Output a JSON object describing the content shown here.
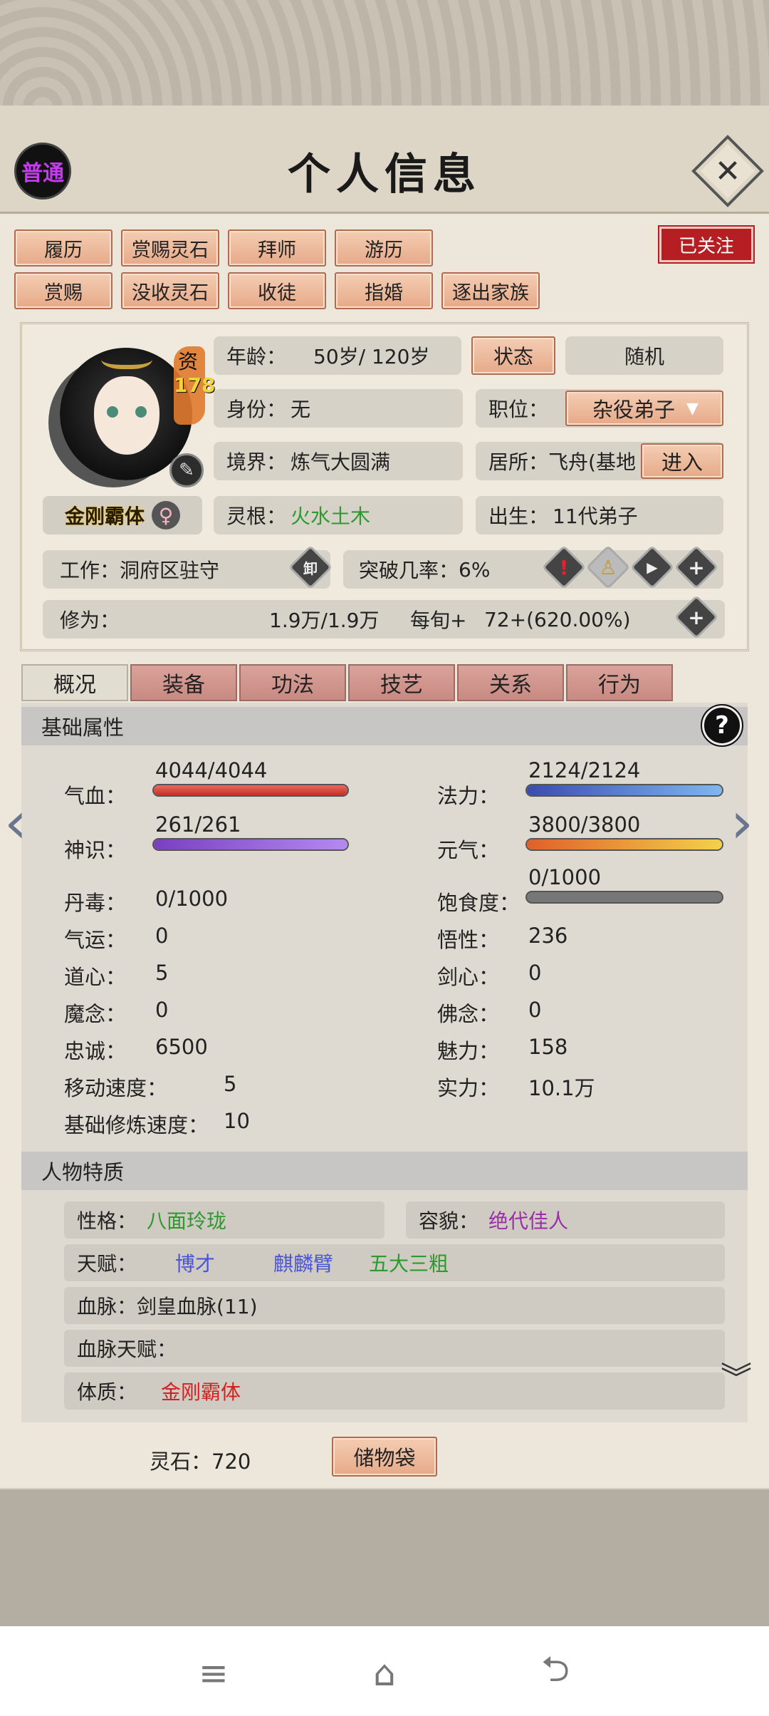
{
  "header": {
    "title": "个人信息",
    "grade_badge": "普通",
    "close_label": "✕"
  },
  "actions_row1": [
    "履历",
    "赏赐灵石",
    "拜师",
    "游历"
  ],
  "actions_row2": [
    "赏赐",
    "没收灵石",
    "收徒",
    "指婚",
    "逐出家族"
  ],
  "follow_label": "已关注",
  "profile": {
    "aptitude_char": "资",
    "aptitude_value": "178",
    "body_type": "金刚霸体",
    "gender_icon": "♀",
    "age_label": "年龄：",
    "age_value": "50岁/ 120岁",
    "status_button": "状态",
    "random_button": "随机",
    "identity_label": "身份：",
    "identity_value": "无",
    "position_label": "职位：",
    "position_value": "杂役弟子",
    "realm_label": "境界：",
    "realm_value": "炼气大圆满",
    "residence_label": "居所：",
    "residence_value": "飞舟(基地",
    "enter_button": "进入",
    "root_label": "灵根：",
    "root_value": "火水土木",
    "birth_label": "出生：",
    "birth_value": "11代弟子",
    "work_label": "工作：",
    "work_value": "洞府区驻守",
    "work_icon_text": "卸",
    "breakthrough_label": "突破几率：",
    "breakthrough_value": "6%",
    "cultivation_label": "修为：",
    "cultivation_value": "1.9万/1.9万",
    "per_period_label": "每旬+",
    "per_period_value": "72+(620.00%)"
  },
  "tabs": [
    "概况",
    "装备",
    "功法",
    "技艺",
    "关系",
    "行为"
  ],
  "attributes": {
    "section_title": "基础属性",
    "help_label": "?",
    "qixue_label": "气血：",
    "qixue_value": "4044/4044",
    "qixue_fill": 1.0,
    "fali_label": "法力：",
    "fali_value": "2124/2124",
    "fali_fill": 1.0,
    "shenshi_label": "神识：",
    "shenshi_value": "261/261",
    "shenshi_fill": 1.0,
    "yuanqi_label": "元气：",
    "yuanqi_value": "3800/3800",
    "yuanqi_fill": 1.0,
    "satiety_label": "饱食度：",
    "satiety_value": "0/1000",
    "satiety_fill": 0.0,
    "left": [
      {
        "label": "丹毒：",
        "value": "0/1000"
      },
      {
        "label": "气运：",
        "value": "0"
      },
      {
        "label": "道心：",
        "value": "5"
      },
      {
        "label": "魔念：",
        "value": "0"
      },
      {
        "label": "忠诚：",
        "value": "6500"
      },
      {
        "label": "移动速度：",
        "value": "5"
      },
      {
        "label": "基础修炼速度：",
        "value": "10"
      }
    ],
    "right": [
      {
        "label": "悟性：",
        "value": "236"
      },
      {
        "label": "剑心：",
        "value": "0"
      },
      {
        "label": "佛念：",
        "value": "0"
      },
      {
        "label": "魅力：",
        "value": "158"
      },
      {
        "label": "实力：",
        "value": "10.1万"
      }
    ]
  },
  "traits": {
    "section_title": "人物特质",
    "personality_label": "性格：",
    "personality_value": "八面玲珑",
    "looks_label": "容貌：",
    "looks_value": "绝代佳人",
    "talent_label": "天赋：",
    "talents": [
      "博才",
      "麒麟臂",
      "五大三粗"
    ],
    "bloodline_label": "血脉：",
    "bloodline_value": "剑皇血脉(11)",
    "bloodline_talent_label": "血脉天赋：",
    "physique_label": "体质：",
    "physique_value": "金刚霸体"
  },
  "footer": {
    "spirit_stone_label": "灵石：",
    "spirit_stone_value": "720",
    "bag_button": "储物袋"
  },
  "colors": {
    "green": "#2e9a2e",
    "purple": "#9a2fa6",
    "blue": "#4a55d6",
    "red": "#d42020",
    "accent": "#e6a988"
  }
}
